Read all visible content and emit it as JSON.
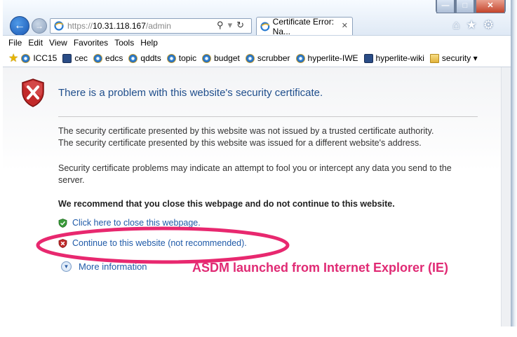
{
  "window": {
    "min_glyph": "—",
    "max_glyph": "□",
    "close_glyph": "✕"
  },
  "nav": {
    "back_icon": "arrow-left-icon",
    "forward_icon": "arrow-right-icon"
  },
  "address": {
    "protocol": "https://",
    "host": "10.31.118.167",
    "path": "/admin",
    "search_icon": "⚲",
    "refresh_icon": "↻"
  },
  "tab": {
    "title": "Certificate Error: Na...",
    "close_glyph": "✕"
  },
  "toolbar_icons": {
    "home": "⌂",
    "favorites": "★",
    "tools": "⚙"
  },
  "menu": [
    "File",
    "Edit",
    "View",
    "Favorites",
    "Tools",
    "Help"
  ],
  "favorites": [
    {
      "label": "ICC15",
      "icon": "ie"
    },
    {
      "label": "cec",
      "icon": "sq"
    },
    {
      "label": "edcs",
      "icon": "ie"
    },
    {
      "label": "qddts",
      "icon": "ie"
    },
    {
      "label": "topic",
      "icon": "ie"
    },
    {
      "label": "budget",
      "icon": "ie"
    },
    {
      "label": "scrubber",
      "icon": "ie"
    },
    {
      "label": "hyperlite-IWE",
      "icon": "ie"
    },
    {
      "label": "hyperlite-wiki",
      "icon": "sq"
    },
    {
      "label": "security ▾",
      "icon": "folder"
    }
  ],
  "overflow_chevron": "»",
  "page": {
    "heading": "There is a problem with this website's security certificate.",
    "line1": "The security certificate presented by this website was not issued by a trusted certificate authority.",
    "line2": "The security certificate presented by this website was issued for a different website's address.",
    "line3": "Security certificate problems may indicate an attempt to fool you or intercept any data you send to the server.",
    "recommend": "We recommend that you close this webpage and do not continue to this website.",
    "close_link": "Click here to close this webpage.",
    "continue_link": "Continue to this website (not recommended).",
    "more_info": "More information"
  },
  "annotation": {
    "text": "ASDM launched from Internet Explorer (IE)",
    "color": "#e02a74"
  }
}
